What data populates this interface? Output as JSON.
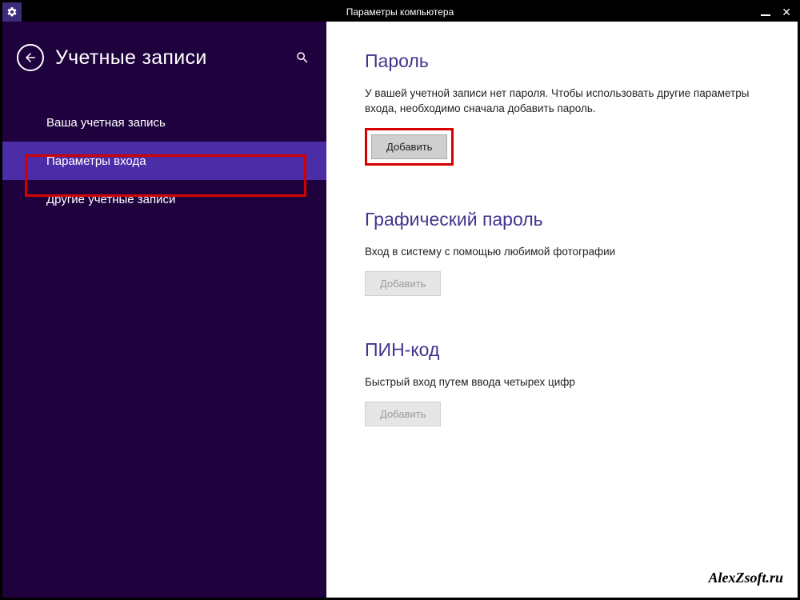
{
  "titlebar": {
    "title": "Параметры компьютера"
  },
  "sidebar": {
    "page_title": "Учетные записи",
    "items": [
      {
        "label": "Ваша учетная запись"
      },
      {
        "label": "Параметры входа"
      },
      {
        "label": "Другие учетные записи"
      }
    ]
  },
  "main": {
    "password": {
      "heading": "Пароль",
      "description": "У вашей учетной записи нет пароля. Чтобы использовать другие параметры входа, необходимо сначала добавить пароль.",
      "button": "Добавить"
    },
    "picture_password": {
      "heading": "Графический пароль",
      "description": "Вход в систему с помощью любимой фотографии",
      "button": "Добавить"
    },
    "pin": {
      "heading": "ПИН-код",
      "description": "Быстрый вход путем ввода четырех цифр",
      "button": "Добавить"
    }
  },
  "watermark": "AlexZsoft.ru"
}
